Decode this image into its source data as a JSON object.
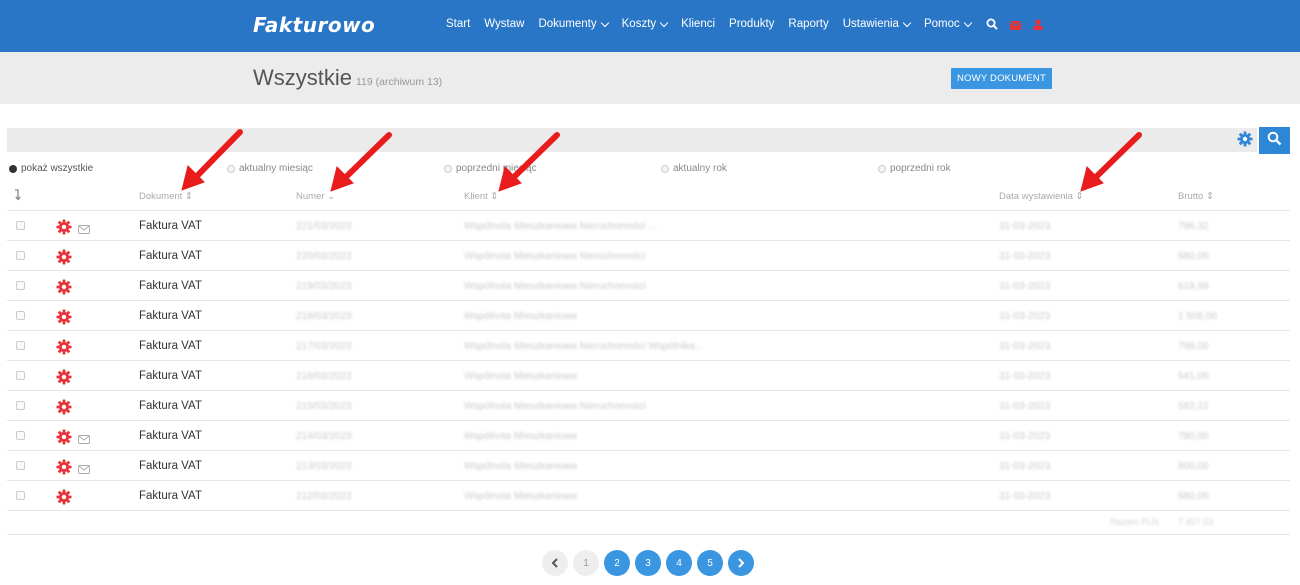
{
  "app": {
    "title": "Fakturowo"
  },
  "nav": {
    "items": [
      {
        "label": "Start",
        "dropdown": false
      },
      {
        "label": "Wystaw",
        "dropdown": false
      },
      {
        "label": "Dokumenty",
        "dropdown": true
      },
      {
        "label": "Koszty",
        "dropdown": true
      },
      {
        "label": "Klienci",
        "dropdown": false
      },
      {
        "label": "Produkty",
        "dropdown": false
      },
      {
        "label": "Raporty",
        "dropdown": false
      },
      {
        "label": "Ustawienia",
        "dropdown": true
      },
      {
        "label": "Pomoc",
        "dropdown": true
      }
    ],
    "icons": [
      "search-icon",
      "envelope-icon",
      "user-icon"
    ]
  },
  "header": {
    "title": "Wszystkie",
    "count": "119 (archiwum 13)",
    "new_button": "NOWY DOKUMENT"
  },
  "filters": [
    {
      "label": "pokaż wszystkie",
      "selected": true
    },
    {
      "label": "aktualny miesiąc",
      "selected": false
    },
    {
      "label": "poprzedni miesiąc",
      "selected": false
    },
    {
      "label": "aktualny rok",
      "selected": false
    },
    {
      "label": "poprzedni rok",
      "selected": false
    }
  ],
  "table": {
    "columns": {
      "sort_icon": "sort-arrow-icon",
      "document": "Dokument ⇕",
      "number": "Numer ⌄",
      "client": "Klient ⇕",
      "date": "Data wystawienia ⇕",
      "gross": "Brutto ⇕"
    },
    "rows": [
      {
        "document": "Faktura VAT",
        "number": "221/03/2023",
        "client": "Wspólnota Mieszkaniowa Nieruchomości ...",
        "date": "31-03-2023",
        "gross": "796,32",
        "mail": true
      },
      {
        "document": "Faktura VAT",
        "number": "220/03/2023",
        "client": "Wspólnota Mieszkaniowa Nieruchomości",
        "date": "31-03-2023",
        "gross": "580,00",
        "mail": false
      },
      {
        "document": "Faktura VAT",
        "number": "219/03/2023",
        "client": "Wspólnota Mieszkaniowa Nieruchomości",
        "date": "31-03-2023",
        "gross": "619,99",
        "mail": false
      },
      {
        "document": "Faktura VAT",
        "number": "218/03/2023",
        "client": "Wspólnota Mieszkaniowa",
        "date": "31-03-2023",
        "gross": "1 508,00",
        "mail": false
      },
      {
        "document": "Faktura VAT",
        "number": "217/03/2023",
        "client": "Wspólnota Mieszkaniowa Nieruchomości Wspólnika...",
        "date": "31-03-2023",
        "gross": "798,00",
        "mail": false
      },
      {
        "document": "Faktura VAT",
        "number": "216/03/2023",
        "client": "Wspólnota Mieszkaniowa",
        "date": "31-03-2023",
        "gross": "541,00",
        "mail": false
      },
      {
        "document": "Faktura VAT",
        "number": "215/03/2023",
        "client": "Wspólnota Mieszkaniowa Nieruchomości",
        "date": "31-03-2023",
        "gross": "582,22",
        "mail": false
      },
      {
        "document": "Faktura VAT",
        "number": "214/03/2023",
        "client": "Wspólnota Mieszkaniowa",
        "date": "31-03-2023",
        "gross": "780,00",
        "mail": true
      },
      {
        "document": "Faktura VAT",
        "number": "213/03/2023",
        "client": "Wspólnota Mieszkaniowa",
        "date": "31-03-2023",
        "gross": "800,00",
        "mail": true
      },
      {
        "document": "Faktura VAT",
        "number": "212/03/2023",
        "client": "Wspólnota Mieszkaniowa",
        "date": "31-03-2023",
        "gross": "580,00",
        "mail": false
      }
    ],
    "sum_label": "Razem PLN",
    "sum_value": "7 457,53"
  },
  "pagination": {
    "prev_icon": "chevron-left-icon",
    "next_icon": "chevron-right-icon",
    "pages": [
      {
        "label": "1",
        "active": false
      },
      {
        "label": "2",
        "active": true
      },
      {
        "label": "3",
        "active": true
      },
      {
        "label": "4",
        "active": true
      },
      {
        "label": "5",
        "active": true
      }
    ]
  },
  "colors": {
    "nav_bg": "#2a76c6",
    "accent": "#3a96e0",
    "gear_red": "#e8333a",
    "arrow_red": "#e81c1c"
  }
}
